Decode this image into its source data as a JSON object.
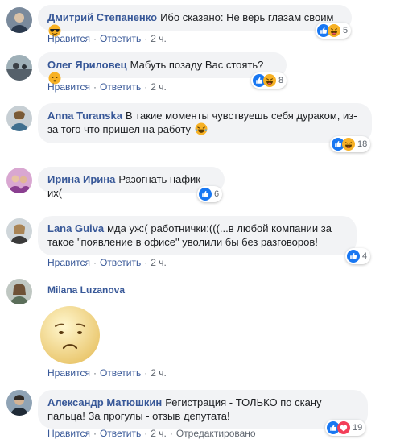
{
  "like_label": "Нравится",
  "reply_label": "Ответить",
  "time_label": "2 ч.",
  "edited_label": "Отредактировано",
  "colors": {
    "link": "#385898",
    "bubble": "#f2f3f5",
    "meta": "#606770",
    "like": "#1877f2",
    "haha": "#f7b125",
    "love": "#f33e58"
  },
  "comments": [
    {
      "author": "Дмитрий Степаненко",
      "text": "Ибо сказано: Не верь глазам своим",
      "emoji": "sunglasses-emoji",
      "reactions": [
        "like-reaction-icon",
        "haha-reaction-icon"
      ],
      "reaction_count": "5"
    },
    {
      "author": "Олег Яриловец",
      "text": "Мабуть позаду Вас стоять?",
      "emoji": "neutral-face-emoji",
      "reactions": [
        "like-reaction-icon",
        "haha-reaction-icon"
      ],
      "reaction_count": "8"
    },
    {
      "author": "Anna Turanska",
      "text": "В такие моменты чувствуешь себя дураком, из-за того что пришел на работу",
      "emoji": "laughing-tears-emoji",
      "reactions": [
        "like-reaction-icon",
        "haha-reaction-icon"
      ],
      "reaction_count": "18"
    },
    {
      "author": "Ирина Ирина",
      "text": "Разогнать нафик их(",
      "reactions": [
        "like-reaction-icon"
      ],
      "reaction_count": "6"
    },
    {
      "author": "Lana Guiva",
      "text": "мда уж:( работнички:(((...в любой компании за такое \"появление в офисе\" уволили бы без разговоров!",
      "reactions": [
        "like-reaction-icon"
      ],
      "reaction_count": "4"
    },
    {
      "author": "Milana Luzanova",
      "sticker": "sad-face-sticker"
    },
    {
      "author": "Александр Матюшкин",
      "text": "Регистрация - ТОЛЬКО по скану пальца! За прогулы - отзыв депутата!",
      "reactions": [
        "like-reaction-icon",
        "love-reaction-icon"
      ],
      "reaction_count": "19"
    }
  ]
}
